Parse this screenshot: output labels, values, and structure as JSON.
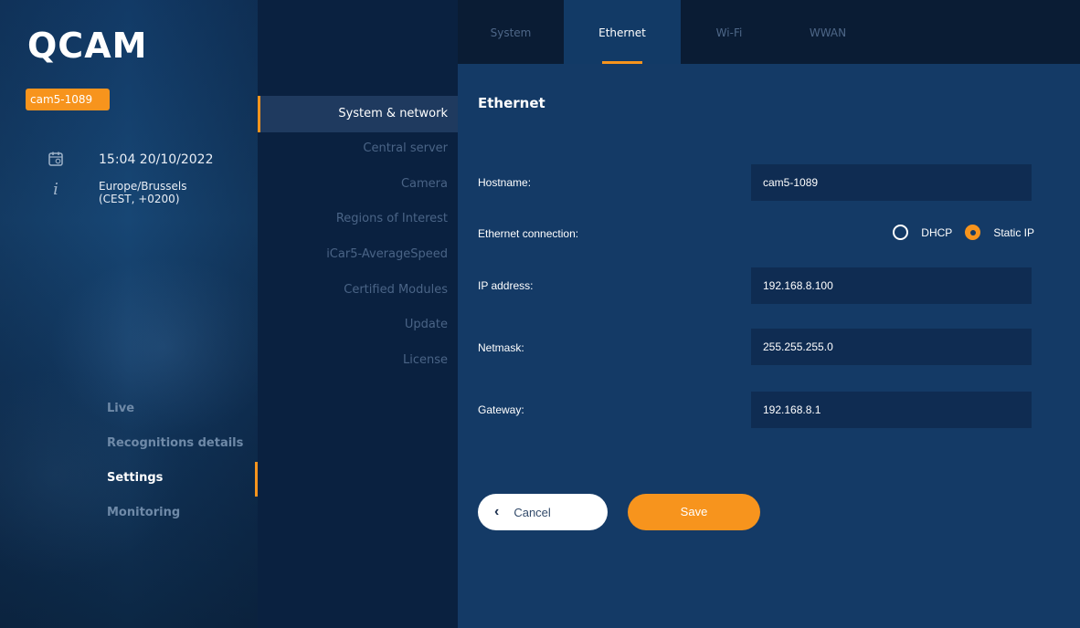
{
  "brand": {
    "logo": "QCAM",
    "device_badge": "cam5-1089",
    "date_time": "15:04 20/10/2022",
    "timezone_line1": "Europe/Brussels",
    "timezone_line2": "(CEST, +0200)"
  },
  "main_nav": {
    "items": [
      "Live",
      "Recognitions details",
      "Settings",
      "Monitoring"
    ],
    "active": "Settings"
  },
  "sub_nav": {
    "items": [
      "System & network",
      "Central server",
      "Camera",
      "Regions of Interest",
      "iCar5-AverageSpeed",
      "Certified Modules",
      "Update",
      "License"
    ],
    "active": "System & network"
  },
  "tabs": {
    "items": [
      "System",
      "Ethernet",
      "Wi-Fi",
      "WWAN"
    ],
    "active": "Ethernet"
  },
  "form": {
    "title": "Ethernet",
    "hostname_label": "Hostname:",
    "hostname_value": "cam5-1089",
    "connection_label": "Ethernet connection:",
    "dhcp_label": "DHCP",
    "static_label": "Static IP",
    "connection_selected": "Static IP",
    "ip_label": "IP address:",
    "ip_value": "192.168.8.100",
    "netmask_label": "Netmask:",
    "netmask_value": "255.255.255.0",
    "gateway_label": "Gateway:",
    "gateway_value": "192.168.8.1"
  },
  "buttons": {
    "cancel": "Cancel",
    "save": "Save"
  },
  "colors": {
    "accent": "#f7941d",
    "content_bg": "#143a66",
    "field_bg": "#0f2c52",
    "subnav_bg": "#0a2140"
  }
}
